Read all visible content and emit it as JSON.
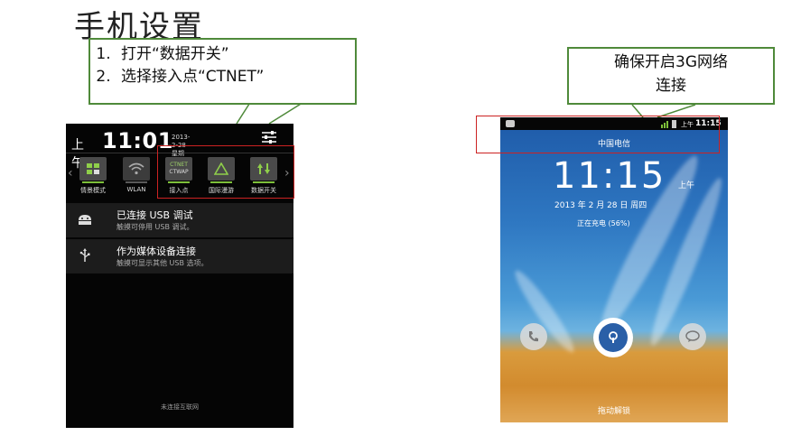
{
  "page_title": "手机设置",
  "callout_left": {
    "items": [
      "打开“数据开关”",
      "选择接入点“CTNET”"
    ]
  },
  "callout_right": {
    "line1": "确保开启3G网络",
    "line2": "连接"
  },
  "left_phone": {
    "ampm": "上午",
    "time": "11:01",
    "date_line1": "2013-2-28",
    "date_line2": "星期四",
    "toggles": [
      {
        "label": "情景模式",
        "icon": "profile-icon",
        "state": "on"
      },
      {
        "label": "WLAN",
        "icon": "wifi-icon",
        "state": "off"
      },
      {
        "label": "接入点",
        "icon": "apn-icon",
        "state": "on",
        "line1": "CTNET",
        "line2": "CTWAP"
      },
      {
        "label": "国际漫游",
        "icon": "roaming-icon",
        "state": "on"
      },
      {
        "label": "数据开关",
        "icon": "data-toggle-icon",
        "state": "on"
      }
    ],
    "notifications": [
      {
        "title": "已连接 USB 调试",
        "subtitle": "触摸可停用 USB 调试。",
        "icon": "android-icon"
      },
      {
        "title": "作为媒体设备连接",
        "subtitle": "触摸可显示其他 USB 选项。",
        "icon": "usb-icon"
      }
    ],
    "footer": "未连接互联网"
  },
  "right_phone": {
    "status_ampm": "上午",
    "status_time": "11:15",
    "carrier": "中国电信",
    "time": "11:15",
    "ampm": "上午",
    "date": "2013 年 2 月 28 日 周四",
    "charging": "正在充电 (56%)",
    "unlock_hint": "拖动解锁"
  },
  "colors": {
    "callout_border": "#4f8a3a",
    "highlight": "#cc2222",
    "toggle_on": "#7ec03a"
  }
}
